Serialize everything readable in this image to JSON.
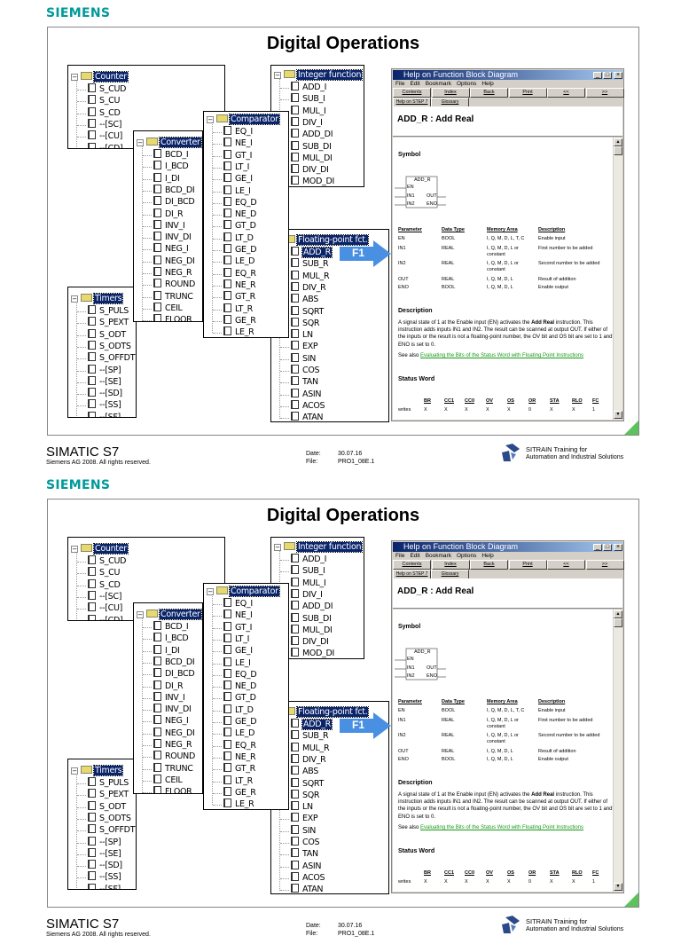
{
  "brand": "SIEMENS",
  "slide_title": "Digital Operations",
  "trees": [
    {
      "key": "counter",
      "label": "Counter",
      "items": [
        "S_CUD",
        "S_CU",
        "S_CD",
        "--[SC]",
        "--[CU]",
        "--[CD]"
      ]
    },
    {
      "key": "timers",
      "label": "Timers",
      "items": [
        "S_PULS",
        "S_PEXT",
        "S_ODT",
        "S_ODTS",
        "S_OFFDT",
        "--[SP]",
        "--[SE]",
        "--[SD]",
        "--[SS]",
        "--[SF]"
      ]
    },
    {
      "key": "converter",
      "label": "Converter",
      "items": [
        "BCD_I",
        "I_BCD",
        "I_DI",
        "BCD_DI",
        "DI_BCD",
        "DI_R",
        "INV_I",
        "INV_DI",
        "NEG_I",
        "NEG_DI",
        "NEG_R",
        "ROUND",
        "TRUNC",
        "CEIL",
        "FLOOR"
      ]
    },
    {
      "key": "comparator",
      "label": "Comparator",
      "items": [
        "EQ_I",
        "NE_I",
        "GT_I",
        "LT_I",
        "GE_I",
        "LE_I",
        "EQ_D",
        "NE_D",
        "GT_D",
        "LT_D",
        "GE_D",
        "LE_D",
        "EQ_R",
        "NE_R",
        "GT_R",
        "LT_R",
        "GE_R",
        "LE_R"
      ]
    },
    {
      "key": "integer",
      "label": "Integer function",
      "items": [
        "ADD_I",
        "SUB_I",
        "MUL_I",
        "DIV_I",
        "ADD_DI",
        "SUB_DI",
        "MUL_DI",
        "DIV_DI",
        "MOD_DI"
      ]
    },
    {
      "key": "floating",
      "label": "Floating-point fct.",
      "items": [
        "ADD_R",
        "SUB_R",
        "MUL_R",
        "DIV_R",
        "ABS",
        "SQRT",
        "SQR",
        "LN",
        "EXP",
        "SIN",
        "COS",
        "TAN",
        "ASIN",
        "ACOS",
        "ATAN"
      ],
      "selected": 0
    }
  ],
  "arrow_label": "F1",
  "help": {
    "title": "Help on Function Block Diagram",
    "menu": [
      "File",
      "Edit",
      "Bookmark",
      "Options",
      "Help"
    ],
    "buttons": [
      "Contents",
      "Index",
      "Back",
      "Print",
      "<<",
      ">>"
    ],
    "buttons2": [
      "Help on STEP 7",
      "Glossary"
    ],
    "heading": "ADD_R : Add Real",
    "symbol_heading": "Symbol",
    "symbol": {
      "name": "ADD_R",
      "en": "EN",
      "in1": "IN1",
      "in2": "IN2",
      "out": "OUT",
      "eno": "ENO"
    },
    "table_headers": [
      "Parameter",
      "Data Type",
      "Memory Area",
      "Description"
    ],
    "table_rows": [
      [
        "EN",
        "BOOL",
        "I, Q, M, D, L, T, C",
        "Enable input"
      ],
      [
        "IN1",
        "REAL",
        "I, Q, M, D, L or constant",
        "First number to be added"
      ],
      [
        "IN2",
        "REAL",
        "I, Q, M, D, L or constant",
        "Second number to be added"
      ],
      [
        "OUT",
        "REAL",
        "I, Q, M, D, L",
        "Result of addition"
      ],
      [
        "ENO",
        "BOOL",
        "I, Q, M, D, L",
        "Enable output"
      ]
    ],
    "description_heading": "Description",
    "description_pre": "A signal state of 1 at the Enable input (EN) activates the ",
    "description_bold": "Add Real",
    "description_post": " instruction. This instruction adds inputs IN1 and IN2. The result can be scanned at output OUT. If either of the inputs or the result is not a floating-point number, the OV bit and OS bit are set to 1 and ENO is set to 0.",
    "see_also": "See also",
    "see_also_link": "Evaluating the Bits of the Status Word with Floating Point Instructions",
    "status_heading": "Status Word",
    "status_headers": [
      "BR",
      "CC1",
      "CC0",
      "OV",
      "OS",
      "OR",
      "STA",
      "RLO",
      "FC"
    ],
    "status_row_label": "writes",
    "status_values": [
      "X",
      "X",
      "X",
      "X",
      "X",
      "0",
      "X",
      "X",
      "1"
    ]
  },
  "footer": {
    "product": "SIMATIC S7",
    "copyright": "Siemens AG 2008. All rights reserved.",
    "date_label": "Date:",
    "date_value": "30.07.16",
    "file_label": "File:",
    "file_value": "PRO1_08E.1",
    "sitrain_1": "SITRAIN Training for",
    "sitrain_2": "Automation and Industrial Solutions"
  },
  "colors": {
    "brand": "#009999",
    "highlight": "#0a246a",
    "arrow": "#4a90e2",
    "link": "#1a9a1a",
    "corner": "#5cc25c"
  }
}
